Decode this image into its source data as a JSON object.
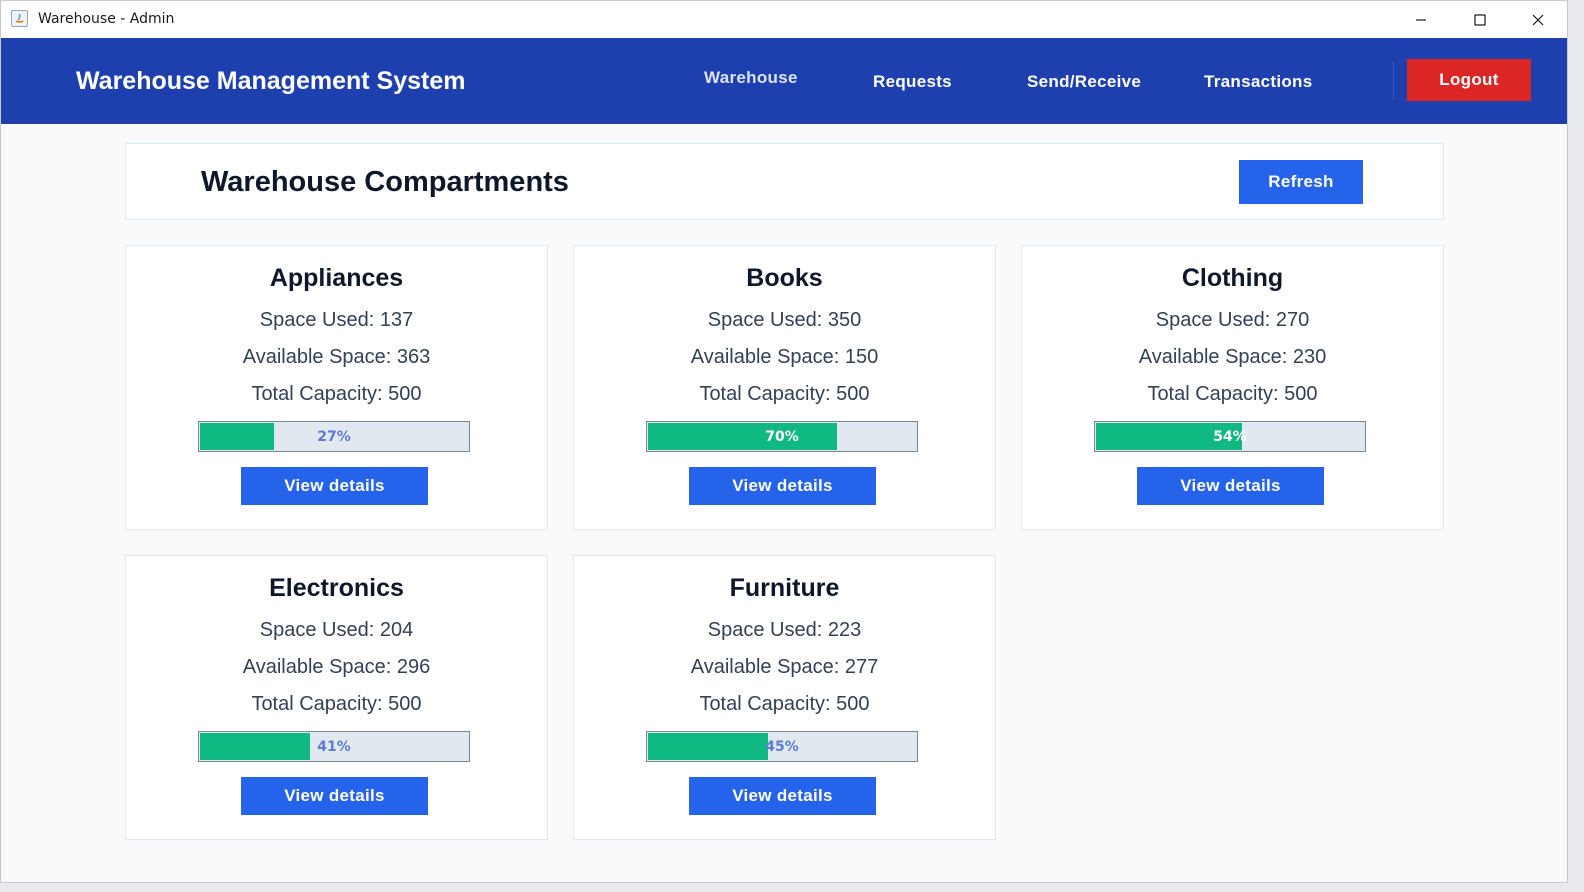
{
  "window": {
    "title": "Warehouse - Admin",
    "controls": {
      "minimize_icon": "minimize-icon",
      "maximize_icon": "maximize-icon",
      "close_icon": "close-icon"
    }
  },
  "navbar": {
    "brand": "Warehouse Management System",
    "links": [
      "Warehouse",
      "Requests",
      "Send/Receive",
      "Transactions"
    ],
    "active": "Warehouse",
    "logout_label": "Logout"
  },
  "header": {
    "title": "Warehouse Compartments",
    "refresh_label": "Refresh"
  },
  "labels": {
    "space_used": "Space Used:",
    "available_space": "Available Space:",
    "total_capacity": "Total Capacity:",
    "view_details": "View details"
  },
  "compartments": [
    {
      "name": "Appliances",
      "used": "137",
      "available": "363",
      "total": "500",
      "percent_label": "27%",
      "fraction": 0.274
    },
    {
      "name": "Books",
      "used": "350",
      "available": "150",
      "total": "500",
      "percent_label": "70%",
      "fraction": 0.7
    },
    {
      "name": "Clothing",
      "used": "270",
      "available": "230",
      "total": "500",
      "percent_label": "54%",
      "fraction": 0.54
    },
    {
      "name": "Electronics",
      "used": "204",
      "available": "296",
      "total": "500",
      "percent_label": "41%",
      "fraction": 0.408
    },
    {
      "name": "Furniture",
      "used": "223",
      "available": "277",
      "total": "500",
      "percent_label": "45%",
      "fraction": 0.446
    }
  ],
  "colors": {
    "nav_bg": "#1e40af",
    "primary": "#2563eb",
    "danger": "#dc2626",
    "progress_fill": "#10b981",
    "progress_track": "#e2e8f0"
  }
}
